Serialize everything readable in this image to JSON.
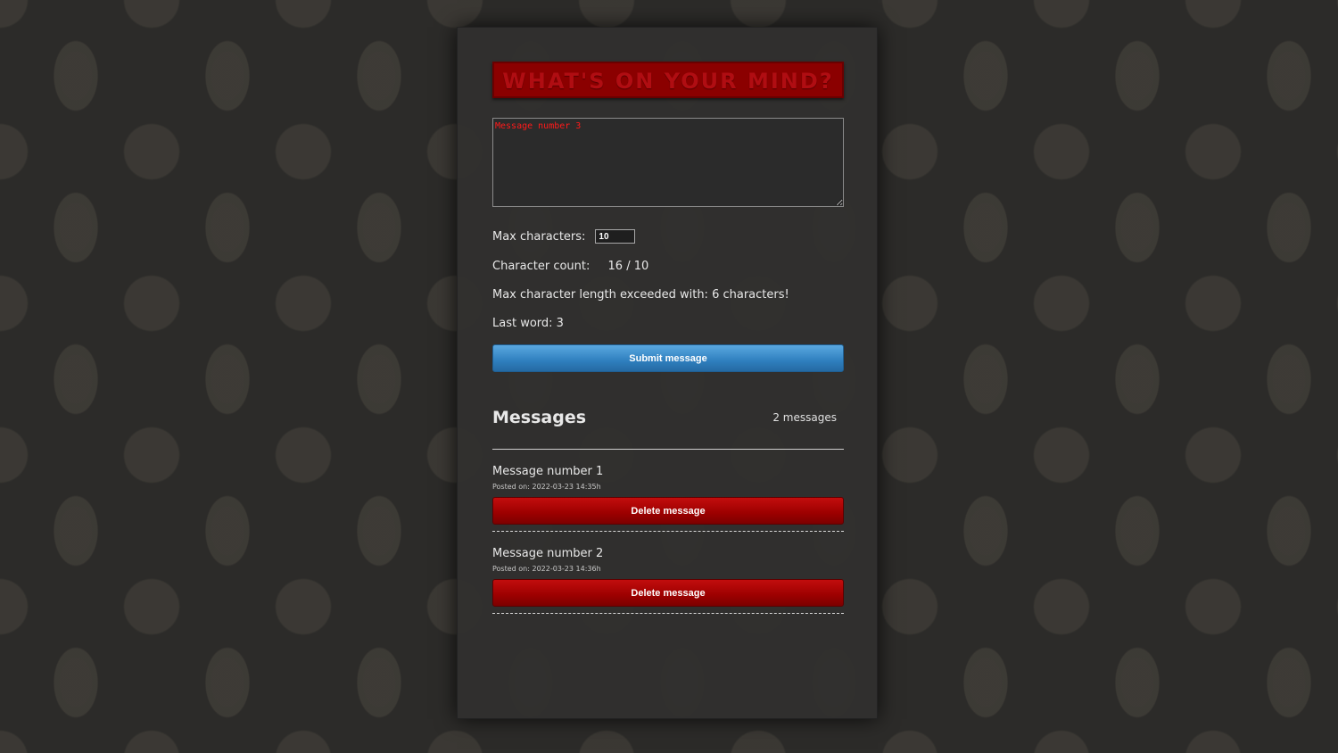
{
  "composer": {
    "title": "WHAT'S ON YOUR MIND?",
    "textarea_value": "Message number 3",
    "max_label": "Max characters:",
    "max_value": "10",
    "count_label": "Character count:",
    "count_value": "16 / 10",
    "exceeded_text": "Max character length exceeded with: 6 characters!",
    "last_word_text": "Last word: 3",
    "submit_label": "Submit message"
  },
  "messages": {
    "title": "Messages",
    "count_text": "2 messages",
    "items": [
      {
        "text": "Message number 1",
        "posted": "Posted on: 2022-03-23 14:35h",
        "delete_label": "Delete message"
      },
      {
        "text": "Message number 2",
        "posted": "Posted on: 2022-03-23 14:36h",
        "delete_label": "Delete message"
      }
    ]
  },
  "colors": {
    "title_bg": "#8b0000",
    "title_text": "#b00d12",
    "submit_button": "#2f7fbe",
    "delete_button": "#9c0000",
    "textarea_text": "#ff1a1a"
  }
}
